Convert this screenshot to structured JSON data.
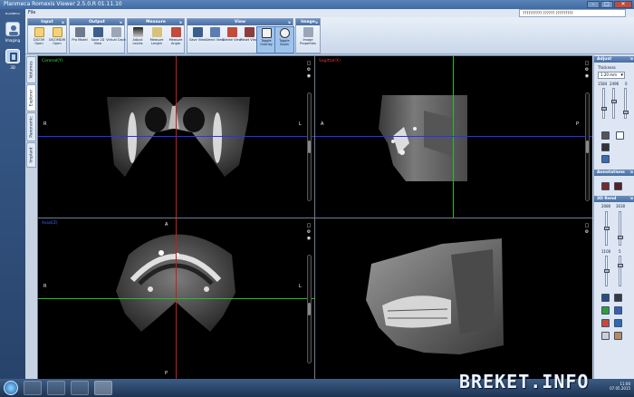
{
  "window": {
    "title": "Planmeca Romexis Viewer 2.5.0.R  01.11.10"
  },
  "product": {
    "logo": "PLANMECA",
    "nav": [
      {
        "label": "Imaging"
      },
      {
        "label": "3D"
      }
    ]
  },
  "menubar": {
    "file": "File"
  },
  "notice": "?????????? ?????? ?????????",
  "ribbon": {
    "groups": [
      {
        "title": "Input",
        "tools": [
          "DICOM Open",
          "DICOMDIR Open"
        ]
      },
      {
        "title": "Output",
        "tools": [
          "Pro Model",
          "Save 2D View",
          "Virtual Ceph"
        ]
      },
      {
        "title": "Measure",
        "tools": [
          "Adjust Levels",
          "Measure Length",
          "Measure Angle"
        ]
      },
      {
        "title": "View",
        "tools": [
          "Save View",
          "Select View",
          "Delete View",
          "Reset View",
          "Toggle Overlay",
          "Toggle Zoom"
        ]
      },
      {
        "title": "Image",
        "tools": [
          "Image Properties"
        ]
      }
    ]
  },
  "tabs": [
    "Volumes",
    "Explorer",
    "Panoramic",
    "Implant"
  ],
  "viewports": {
    "coronal": {
      "label": "Coronal(Y)",
      "left": "R",
      "right": "L"
    },
    "sagittal": {
      "label": "Sagittal(X)",
      "left": "A",
      "right": "P"
    },
    "axial": {
      "label": "Axial(Z)",
      "top": "A",
      "bottom": "P",
      "left": "R",
      "right": "L"
    }
  },
  "right_panel": {
    "adjust": {
      "title": "Adjust",
      "thickness_label": "Thickness",
      "thickness_value": "1.20 mm",
      "val_a": "1584",
      "val_b": "2496",
      "val_c": "0"
    },
    "annotations": {
      "title": "Annotations"
    },
    "render": {
      "title": "3D Rend",
      "val_a": "2080",
      "val_b": "3030",
      "val_c": "1100",
      "val_d": "5"
    }
  },
  "taskbar": {
    "time": "11:00",
    "date": "07.05.2015"
  },
  "watermark": "BREKET.INFO",
  "colors": {
    "coronal": "#3cdc3c",
    "sagittal": "#e23a3a",
    "axial": "#4a63ff",
    "crosshair_red": "#cc1a1a",
    "crosshair_green": "#22c122",
    "crosshair_blue": "#2233ff"
  }
}
